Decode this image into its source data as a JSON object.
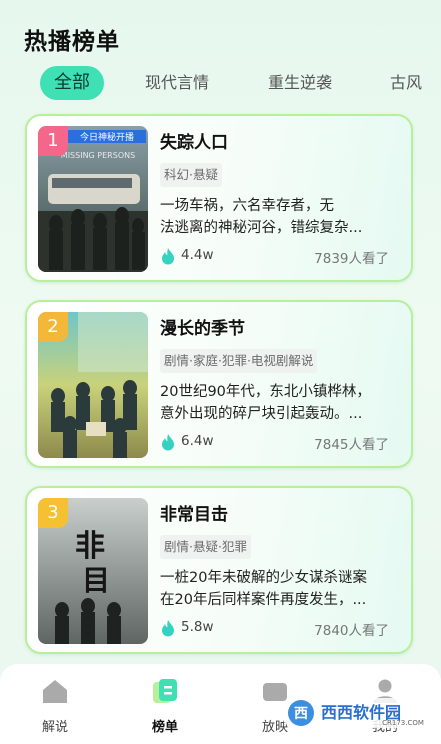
{
  "page_title": "热播榜单",
  "tabs": [
    {
      "label": "全部",
      "active": true
    },
    {
      "label": "现代言情",
      "active": false
    },
    {
      "label": "重生逆袭",
      "active": false
    },
    {
      "label": "古风",
      "active": false
    }
  ],
  "cards": [
    {
      "rank": "1",
      "rank_color": "#f5678a",
      "title": "失踪人口",
      "tags": "科幻·悬疑",
      "desc_line1": "一场车祸，六名幸存者，无",
      "desc_line2": "法逃离的神秘河谷，错综复杂...",
      "heat": "4.4w",
      "viewers": "7839人看了",
      "poster_text": "今日神秘开播",
      "poster_sub": "MISSING PERSONS"
    },
    {
      "rank": "2",
      "rank_color": "#f4b73a",
      "title": "漫长的季节",
      "tags": "剧情·家庭·犯罪·电视剧解说",
      "desc_line1": "20世纪90年代，东北小镇桦林，",
      "desc_line2": "意外出现的碎尸块引起轰动。...",
      "heat": "6.4w",
      "viewers": "7845人看了"
    },
    {
      "rank": "3",
      "rank_color": "#f6c033",
      "title": "非常目击",
      "tags": "剧情·悬疑·犯罪",
      "desc_line1": "一桩20年未破解的少女谋杀谜案",
      "desc_line2": "在20年后同样案件再度发生，...",
      "heat": "5.8w",
      "viewers": "7840人看了"
    }
  ],
  "nav": [
    {
      "label": "解说",
      "icon": "home-icon",
      "active": false
    },
    {
      "label": "榜单",
      "icon": "ranking-icon",
      "active": true
    },
    {
      "label": "放映",
      "icon": "screening-icon",
      "active": false
    },
    {
      "label": "我的",
      "icon": "profile-icon",
      "active": false
    }
  ],
  "watermark": {
    "text": "西西软件园",
    "sub": "CR173.COM"
  },
  "colors": {
    "accent": "#3ee0b4",
    "card_border": "#b8ef9a",
    "fire": "#35d2c2"
  }
}
